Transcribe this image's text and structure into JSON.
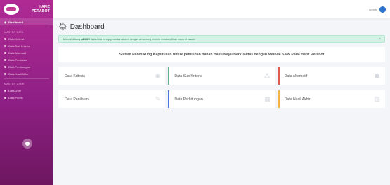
{
  "brand": {
    "name_line1": "HAFIZ",
    "name_line2": "PERABOT"
  },
  "sidebar": {
    "active": "Dashboard",
    "heading1": "MASTER DATA",
    "items1": [
      "Data Kriteria",
      "Data Sub Kriteria",
      "Data Alternatif",
      "Data Penilaian",
      "Data Perhitungan",
      "Data Hasil Akhir"
    ],
    "heading2": "MASTER USER",
    "items2": [
      "Data User",
      "Data Profile"
    ]
  },
  "topbar": {
    "user": "admin"
  },
  "page": {
    "title": "Dashboard"
  },
  "alert": {
    "prefix": "Selamat datang",
    "user": "ADMIN!",
    "suffix": "Anda bisa mengoperasikan sistem dengan wewenang tertentu melalui pilihan menu di bawah.",
    "close": "×"
  },
  "banner": "Sistem Pendukung Keputusan untuk pemilihan bahan Baku Kayu Berkualitas dengan Metode SAW Pada Hafiz Perabot",
  "cards": [
    {
      "label": "Data Kriteria",
      "icon": "cube-icon"
    },
    {
      "label": "Data Sub Kriteria",
      "icon": "cubes-icon"
    },
    {
      "label": "Data Alternatif",
      "icon": "users-icon"
    },
    {
      "label": "Data Penilaian",
      "icon": "edit-icon"
    },
    {
      "label": "Data Perhitungan",
      "icon": "calculator-icon"
    },
    {
      "label": "Data Hasil Akhir",
      "icon": "chart-icon"
    }
  ]
}
